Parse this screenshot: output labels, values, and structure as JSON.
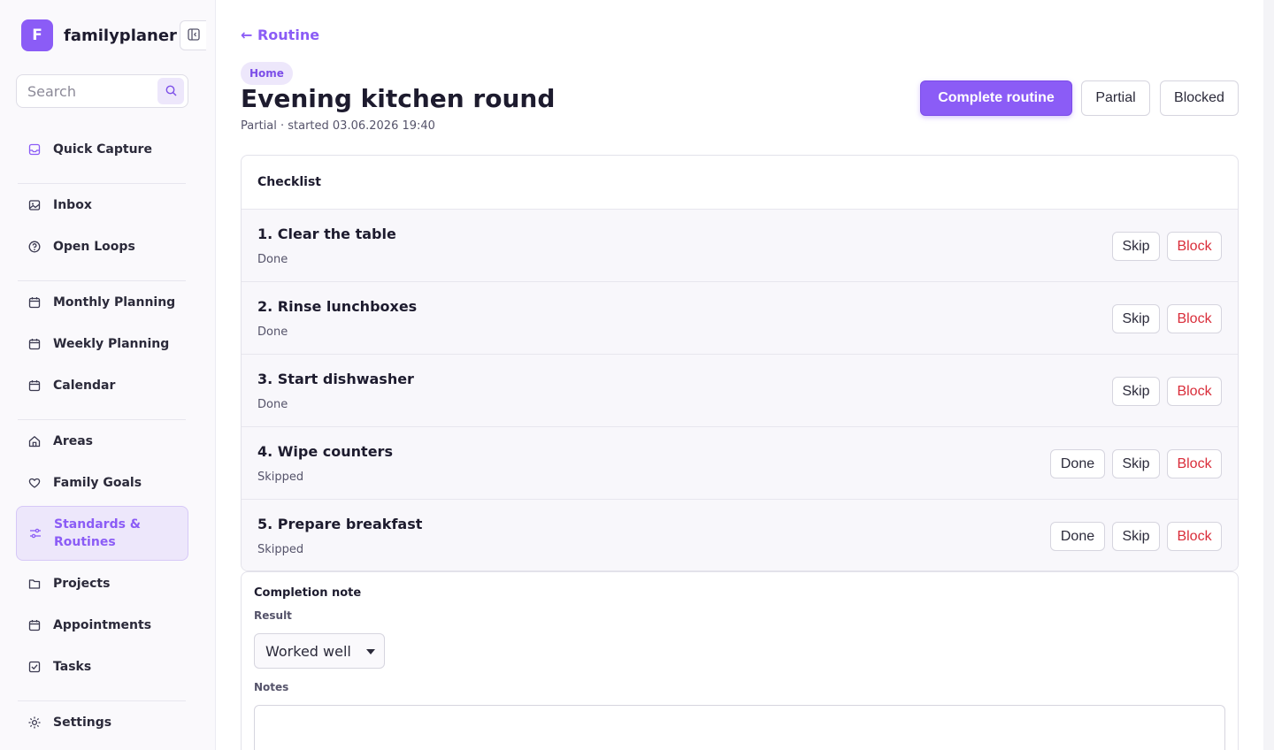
{
  "brand": {
    "logo_letter": "F",
    "name": "familyplaner"
  },
  "search": {
    "placeholder": "Search",
    "value": ""
  },
  "sidebar": {
    "items": [
      {
        "label": "Quick Capture",
        "icon": "inbox-tray-icon"
      },
      {
        "label": "Inbox",
        "icon": "image-icon"
      },
      {
        "label": "Open Loops",
        "icon": "question-circle-icon"
      },
      {
        "label": "Monthly Planning",
        "icon": "calendar-icon"
      },
      {
        "label": "Weekly Planning",
        "icon": "calendar-icon"
      },
      {
        "label": "Calendar",
        "icon": "calendar-icon"
      },
      {
        "label": "Areas",
        "icon": "home-icon"
      },
      {
        "label": "Family Goals",
        "icon": "heart-icon"
      },
      {
        "label": "Standards & Routines",
        "icon": "sliders-icon",
        "active": true
      },
      {
        "label": "Projects",
        "icon": "folder-icon"
      },
      {
        "label": "Appointments",
        "icon": "calendar-icon"
      },
      {
        "label": "Tasks",
        "icon": "checkbox-icon"
      },
      {
        "label": "Settings",
        "icon": "sun-gear-icon"
      }
    ]
  },
  "header": {
    "back_label": "← Routine",
    "area_tag": "Home",
    "title": "Evening kitchen round",
    "subtitle": "Partial · started 03.06.2026 19:40",
    "actions": {
      "complete": "Complete routine",
      "partial": "Partial",
      "blocked": "Blocked"
    }
  },
  "checklist": {
    "title": "Checklist",
    "items": [
      {
        "title": "1. Clear the table",
        "status": "Done"
      },
      {
        "title": "2. Rinse lunchboxes",
        "status": "Done"
      },
      {
        "title": "3. Start dishwasher",
        "status": "Done"
      },
      {
        "title": "4. Wipe counters",
        "status": "Skipped"
      },
      {
        "title": "5. Prepare breakfast",
        "status": "Skipped"
      }
    ],
    "button_labels": {
      "done": "Done",
      "skip": "Skip",
      "block": "Block"
    }
  },
  "completion": {
    "title": "Completion note",
    "result_label": "Result",
    "result_value": "Worked well",
    "notes_label": "Notes",
    "notes_value": ""
  },
  "colors": {
    "accent": "#8b5cf6",
    "danger": "#d92d3a",
    "active_bg": "#ede7fb"
  }
}
